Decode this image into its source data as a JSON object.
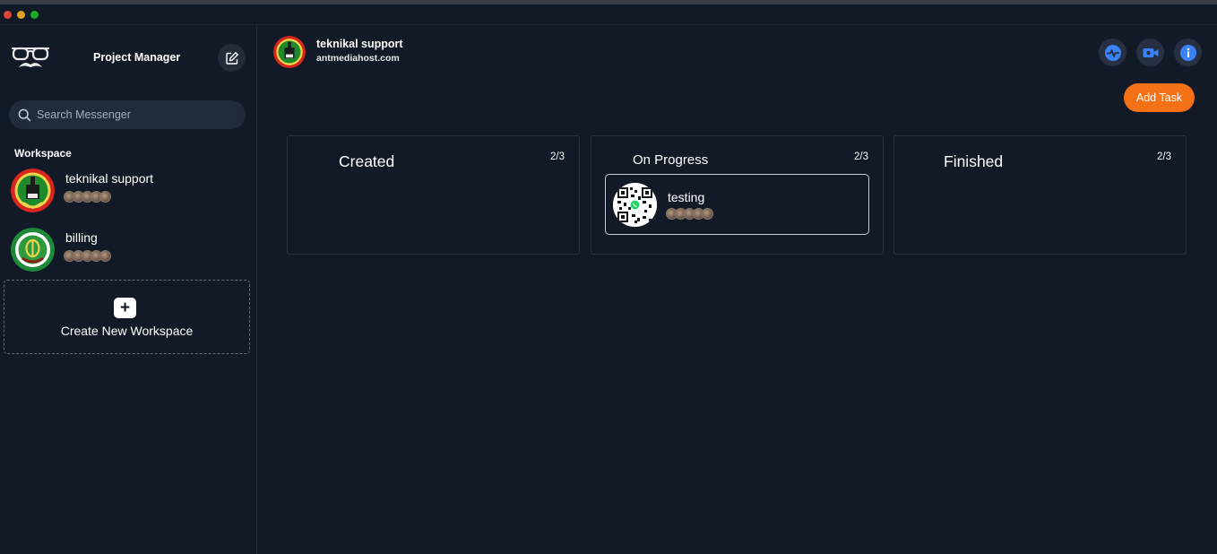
{
  "window": {
    "traffic_lights": [
      "close",
      "minimize",
      "zoom"
    ]
  },
  "sidebar": {
    "app_title": "Project Manager",
    "logo_icon": "glasses-mustache-icon",
    "edit_icon": "edit-icon",
    "search": {
      "placeholder": "Search Messenger",
      "value": ""
    },
    "section_label": "Workspace",
    "workspaces": [
      {
        "name": "teknikal support",
        "avatar": "green-red-emblem",
        "member_count": 5
      },
      {
        "name": "billing",
        "avatar": "green-white-emblem",
        "member_count": 5
      }
    ],
    "create_workspace_label": "Create New Workspace"
  },
  "header": {
    "title": "teknikal support",
    "subtitle": "antmediahost.com",
    "actions": [
      "activity-icon",
      "video-icon",
      "info-icon"
    ]
  },
  "board": {
    "add_task_label": "Add Task",
    "accent": "#f47215",
    "columns": [
      {
        "title": "Created",
        "count": "2/3",
        "tasks": []
      },
      {
        "title": "On Progress",
        "count": "2/3",
        "tasks": [
          {
            "title": "testing",
            "member_count": 5
          }
        ]
      },
      {
        "title": "Finished",
        "count": "2/3",
        "tasks": []
      }
    ]
  }
}
